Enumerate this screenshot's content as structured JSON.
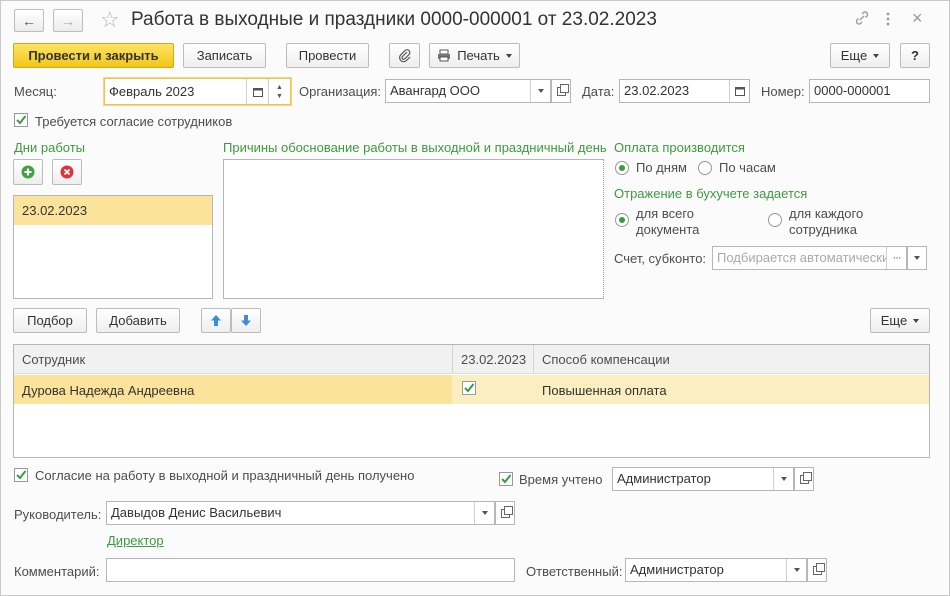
{
  "window": {
    "title": "Работа в выходные и праздники 0000-000001 от 23.02.2023",
    "back_icon": "arrow-left",
    "forward_icon": "arrow-right",
    "favorite_icon": "star",
    "link_icon": "chain-link",
    "menu_icon": "vertical-ellipsis",
    "close_icon": "×"
  },
  "toolbar": {
    "post_close": "Провести и закрыть",
    "save": "Записать",
    "post": "Провести",
    "print": "Печать",
    "more": "Еще",
    "help": "?"
  },
  "fields": {
    "month_label": "Месяц:",
    "month_value": "Февраль 2023",
    "org_label": "Организация:",
    "org_value": "Авангард ООО",
    "date_label": "Дата:",
    "date_value": "23.02.2023",
    "number_label": "Номер:",
    "number_value": "0000-000001"
  },
  "consent_required": "Требуется согласие сотрудников",
  "work_days": {
    "header": "Дни работы",
    "items": [
      "23.02.2023"
    ]
  },
  "reasons": {
    "header": "Причины обоснование работы в выходной и праздничный день",
    "value": ""
  },
  "payment": {
    "header": "Оплата производится",
    "by_days": "По дням",
    "by_hours": "По часам",
    "accounting_header": "Отражение в бухучете задается",
    "whole_doc_line1": "для всего",
    "whole_doc_line2": "документа",
    "each_emp_line1": "для каждого",
    "each_emp_line2": "сотрудника",
    "account_label": "Счет, субконто:",
    "account_placeholder": "Подбирается автоматически"
  },
  "table_toolbar": {
    "select": "Подбор",
    "add": "Добавить",
    "more": "Еще"
  },
  "table": {
    "columns": [
      "Сотрудник",
      "23.02.2023",
      "Способ компенсации"
    ],
    "rows": [
      {
        "employee": "Дурова Надежда Андреевна",
        "checked": true,
        "compensation": "Повышенная оплата"
      }
    ]
  },
  "footer": {
    "consent_received": "Согласие на работу в выходной и праздничный день получено",
    "time_accounted": "Время учтено",
    "time_user": "Администратор",
    "manager_label": "Руководитель:",
    "manager_value": "Давыдов Денис Васильевич",
    "manager_position": "Директор",
    "comment_label": "Комментарий:",
    "comment_value": "",
    "responsible_label": "Ответственный:",
    "responsible_value": "Администратор"
  },
  "colors": {
    "accent_green": "#3e9a3f",
    "primary_yellow": "#f2c618",
    "selection_yellow": "#fbe39b"
  }
}
